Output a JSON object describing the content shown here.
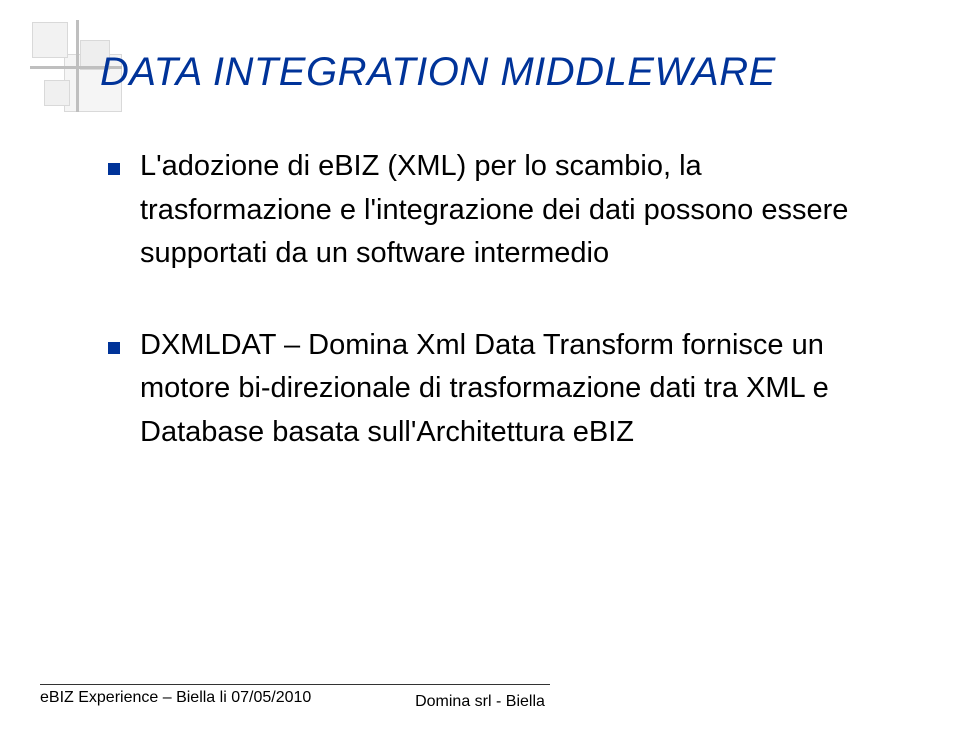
{
  "title": "DATA INTEGRATION MIDDLEWARE",
  "bullets": [
    "L'adozione di eBIZ (XML) per lo scambio, la trasformazione e l'integrazione dei dati possono essere supportati da un software intermedio",
    "DXMLDAT – Domina Xml Data Transform fornisce un motore bi-direzionale di trasformazione dati tra XML e Database basata sull'Architettura eBIZ"
  ],
  "footer": {
    "left": "eBIZ Experience – Biella li  07/05/2010",
    "center": "Domina srl - Biella"
  }
}
